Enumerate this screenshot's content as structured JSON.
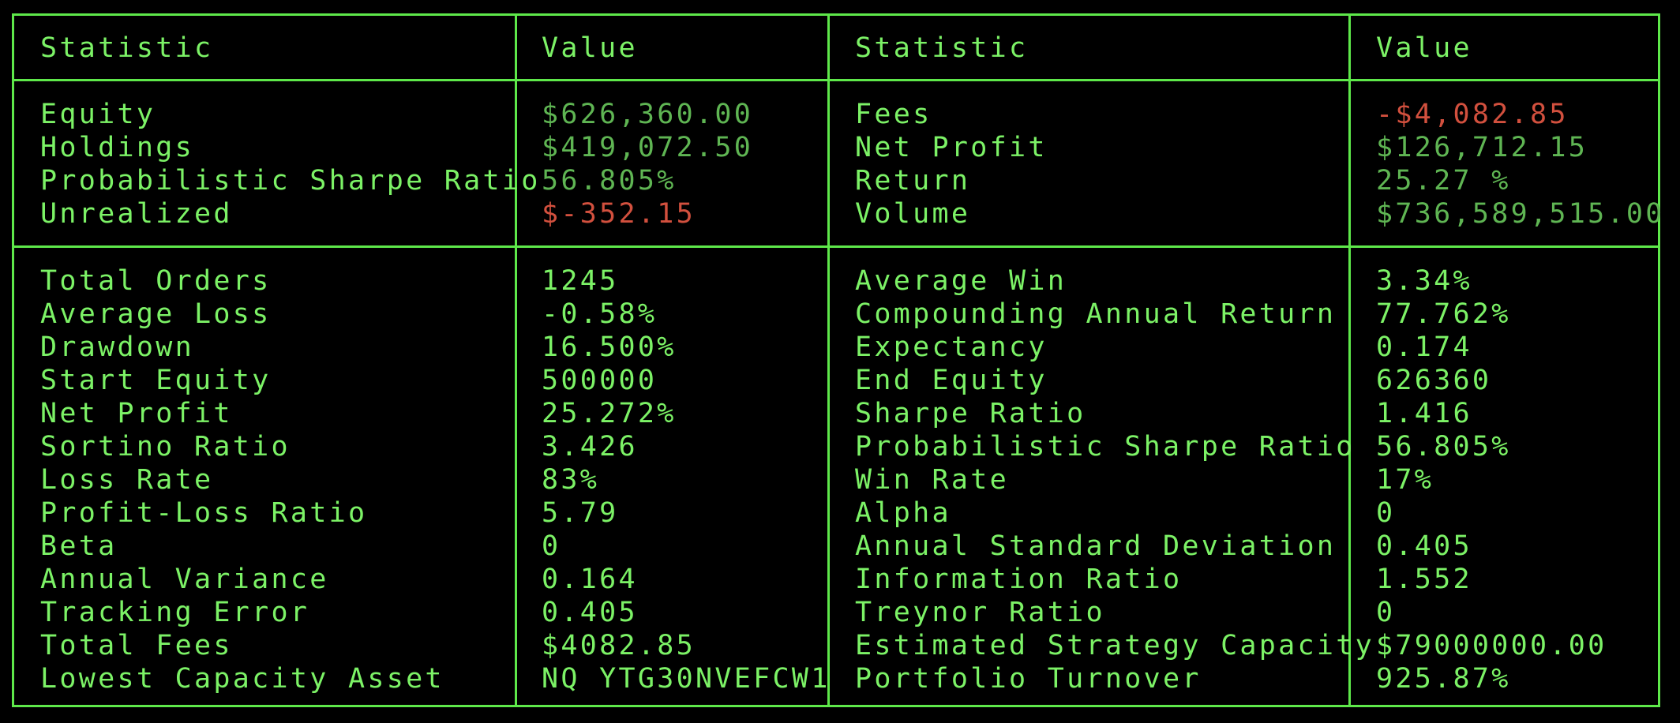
{
  "colors": {
    "background": "#000000",
    "border": "#5ee84a",
    "text": "#7cf266",
    "summary_value": "#5fb553",
    "negative_value": "#d2503e"
  },
  "headers": {
    "left_statistic": "Statistic",
    "left_value": "Value",
    "right_statistic": "Statistic",
    "right_value": "Value"
  },
  "summary": {
    "left": [
      {
        "label": "Equity",
        "value": "$626,360.00",
        "negative": false
      },
      {
        "label": "Holdings",
        "value": "$419,072.50",
        "negative": false
      },
      {
        "label": "Probabilistic Sharpe Ratio",
        "value": "56.805%",
        "negative": false
      },
      {
        "label": "Unrealized",
        "value": "$-352.15",
        "negative": true
      }
    ],
    "right": [
      {
        "label": "Fees",
        "value": "-$4,082.85",
        "negative": true
      },
      {
        "label": "Net Profit",
        "value": "$126,712.15",
        "negative": false
      },
      {
        "label": "Return",
        "value": "25.27 %",
        "negative": false
      },
      {
        "label": "Volume",
        "value": "$736,589,515.00",
        "negative": false
      }
    ]
  },
  "statistics": {
    "left": [
      {
        "label": "Total Orders",
        "value": "1245"
      },
      {
        "label": "Average Loss",
        "value": "-0.58%"
      },
      {
        "label": "Drawdown",
        "value": "16.500%"
      },
      {
        "label": "Start Equity",
        "value": "500000"
      },
      {
        "label": "Net Profit",
        "value": "25.272%"
      },
      {
        "label": "Sortino Ratio",
        "value": "3.426"
      },
      {
        "label": "Loss Rate",
        "value": "83%"
      },
      {
        "label": "Profit-Loss Ratio",
        "value": "5.79"
      },
      {
        "label": "Beta",
        "value": "0"
      },
      {
        "label": "Annual Variance",
        "value": "0.164"
      },
      {
        "label": "Tracking Error",
        "value": "0.405"
      },
      {
        "label": "Total Fees",
        "value": "$4082.85"
      },
      {
        "label": "Lowest Capacity Asset",
        "value": "NQ YTG30NVEFCW1"
      }
    ],
    "right": [
      {
        "label": "Average Win",
        "value": "3.34%"
      },
      {
        "label": "Compounding Annual Return",
        "value": "77.762%"
      },
      {
        "label": "Expectancy",
        "value": "0.174"
      },
      {
        "label": "End Equity",
        "value": "626360"
      },
      {
        "label": "Sharpe Ratio",
        "value": "1.416"
      },
      {
        "label": "Probabilistic Sharpe Ratio",
        "value": "56.805%"
      },
      {
        "label": "Win Rate",
        "value": "17%"
      },
      {
        "label": "Alpha",
        "value": "0"
      },
      {
        "label": "Annual Standard Deviation",
        "value": "0.405"
      },
      {
        "label": "Information Ratio",
        "value": "1.552"
      },
      {
        "label": "Treynor Ratio",
        "value": "0"
      },
      {
        "label": "Estimated Strategy Capacity",
        "value": "$79000000.00"
      },
      {
        "label": "Portfolio Turnover",
        "value": "925.87%"
      }
    ]
  }
}
